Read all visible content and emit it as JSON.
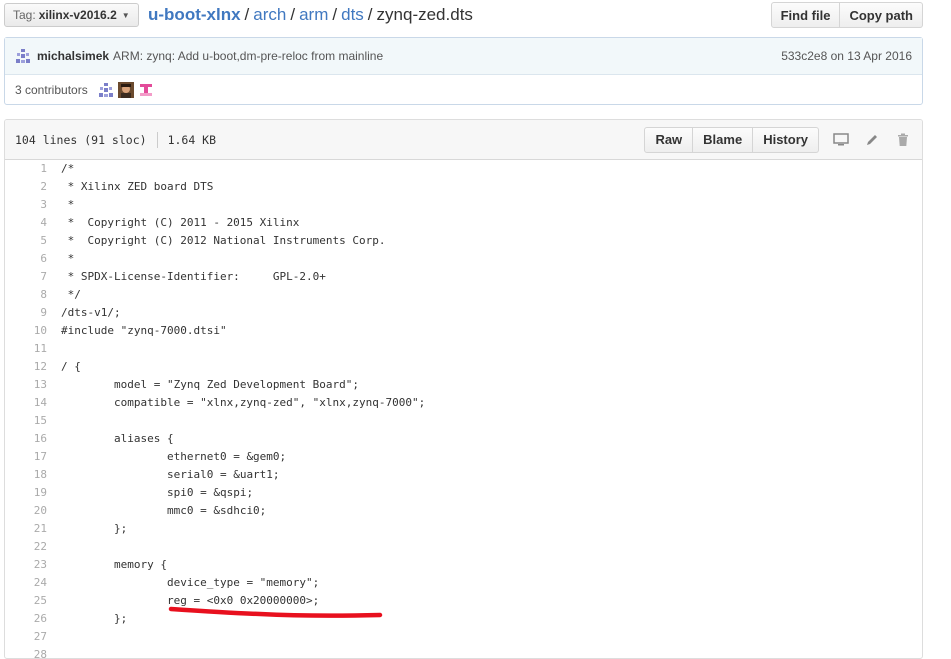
{
  "tag": {
    "label": "Tag:",
    "value": "xilinx-v2016.2"
  },
  "breadcrumb": {
    "repo": "u-boot-xlnx",
    "sep": "/",
    "segments": [
      "arch",
      "arm",
      "dts"
    ],
    "file": "zynq-zed.dts"
  },
  "top_buttons": {
    "find_file": "Find file",
    "copy_path": "Copy path"
  },
  "commit": {
    "author": "michalsimek",
    "message": "ARM: zynq: Add u-boot,dm-pre-reloc from mainline",
    "sha": "533c2e8",
    "date_text": "on 13 Apr 2016",
    "contributors_text": "3 contributors"
  },
  "file_info": {
    "lines": "104 lines (91 sloc)",
    "size": "1.64 KB"
  },
  "file_buttons": {
    "raw": "Raw",
    "blame": "Blame",
    "history": "History"
  },
  "icons": {
    "desktop": "desktop-icon",
    "edit": "pencil-icon",
    "delete": "trash-icon"
  },
  "colors": {
    "link": "#4078c0",
    "annotation": "#e8101e"
  },
  "code_lines": [
    {
      "n": "1",
      "t": "/*"
    },
    {
      "n": "2",
      "t": " * Xilinx ZED board DTS"
    },
    {
      "n": "3",
      "t": " *"
    },
    {
      "n": "4",
      "t": " *  Copyright (C) 2011 - 2015 Xilinx"
    },
    {
      "n": "5",
      "t": " *  Copyright (C) 2012 National Instruments Corp."
    },
    {
      "n": "6",
      "t": " *"
    },
    {
      "n": "7",
      "t": " * SPDX-License-Identifier:\tGPL-2.0+"
    },
    {
      "n": "8",
      "t": " */"
    },
    {
      "n": "9",
      "t": "/dts-v1/;"
    },
    {
      "n": "10",
      "t": "#include \"zynq-7000.dtsi\""
    },
    {
      "n": "11",
      "t": ""
    },
    {
      "n": "12",
      "t": "/ {"
    },
    {
      "n": "13",
      "t": "\tmodel = \"Zynq Zed Development Board\";"
    },
    {
      "n": "14",
      "t": "\tcompatible = \"xlnx,zynq-zed\", \"xlnx,zynq-7000\";"
    },
    {
      "n": "15",
      "t": ""
    },
    {
      "n": "16",
      "t": "\taliases {"
    },
    {
      "n": "17",
      "t": "\t\tethernet0 = &gem0;"
    },
    {
      "n": "18",
      "t": "\t\tserial0 = &uart1;"
    },
    {
      "n": "19",
      "t": "\t\tspi0 = &qspi;"
    },
    {
      "n": "20",
      "t": "\t\tmmc0 = &sdhci0;"
    },
    {
      "n": "21",
      "t": "\t};"
    },
    {
      "n": "22",
      "t": ""
    },
    {
      "n": "23",
      "t": "\tmemory {"
    },
    {
      "n": "24",
      "t": "\t\tdevice_type = \"memory\";"
    },
    {
      "n": "25",
      "t": "\t\treg = <0x0 0x20000000>;"
    },
    {
      "n": "26",
      "t": "\t};"
    },
    {
      "n": "27",
      "t": ""
    },
    {
      "n": "28",
      "t": ""
    }
  ]
}
